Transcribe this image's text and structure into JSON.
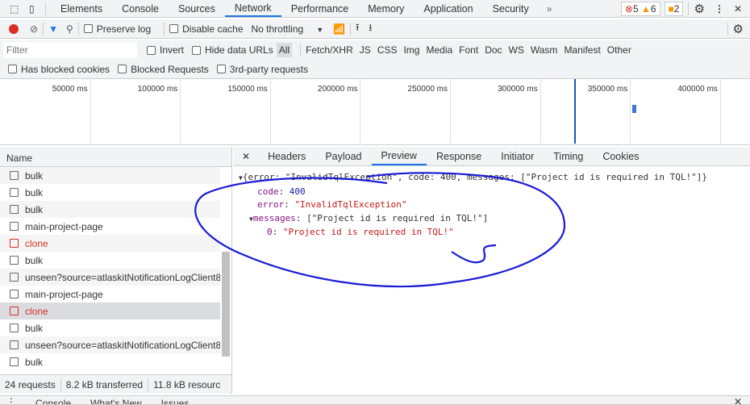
{
  "tabs": [
    "Elements",
    "Console",
    "Sources",
    "Network",
    "Performance",
    "Memory",
    "Application",
    "Security"
  ],
  "more": "»",
  "badges": {
    "errors": "5",
    "warnings": "6",
    "issues": "2"
  },
  "toolbar": {
    "preserve_log": "Preserve log",
    "disable_cache": "Disable cache",
    "throttling": "No throttling"
  },
  "filter": {
    "placeholder": "Filter",
    "invert": "Invert",
    "hide_data_urls": "Hide data URLs",
    "types": [
      "All",
      "Fetch/XHR",
      "JS",
      "CSS",
      "Img",
      "Media",
      "Font",
      "Doc",
      "WS",
      "Wasm",
      "Manifest",
      "Other"
    ]
  },
  "filter2": [
    "Has blocked cookies",
    "Blocked Requests",
    "3rd-party requests"
  ],
  "timeline_ticks": [
    "50000 ms",
    "100000 ms",
    "150000 ms",
    "200000 ms",
    "250000 ms",
    "300000 ms",
    "350000 ms",
    "400000 ms"
  ],
  "list": {
    "header": "Name",
    "rows": [
      {
        "name": "bulk",
        "status": "ok"
      },
      {
        "name": "bulk",
        "status": "ok"
      },
      {
        "name": "bulk",
        "status": "ok"
      },
      {
        "name": "main-project-page",
        "status": "ok"
      },
      {
        "name": "clone",
        "status": "error"
      },
      {
        "name": "bulk",
        "status": "ok"
      },
      {
        "name": "unseen?source=atlaskitNotificationLogClient8",
        "status": "ok"
      },
      {
        "name": "main-project-page",
        "status": "ok"
      },
      {
        "name": "clone",
        "status": "error",
        "selected": true
      },
      {
        "name": "bulk",
        "status": "ok"
      },
      {
        "name": "unseen?source=atlaskitNotificationLogClient8",
        "status": "ok"
      },
      {
        "name": "bulk",
        "status": "ok"
      }
    ]
  },
  "summary": {
    "requests": "24 requests",
    "transferred": "8.2 kB transferred",
    "resources": "11.8 kB resourc"
  },
  "detail_tabs": [
    "Headers",
    "Payload",
    "Preview",
    "Response",
    "Initiator",
    "Timing",
    "Cookies"
  ],
  "preview": {
    "summary_line": "{error: \"InvalidTqlException\", code: 400, messages: [\"Project id is required in TQL!\"]}",
    "code_key": "code",
    "code_val": "400",
    "error_key": "error",
    "error_val": "\"InvalidTqlException\"",
    "messages_key": "messages",
    "messages_val": "[\"Project id is required in TQL!\"]",
    "item_key": "0",
    "item_val": "\"Project id is required in TQL!\""
  },
  "drawer": [
    "Console",
    "What's New",
    "Issues"
  ]
}
